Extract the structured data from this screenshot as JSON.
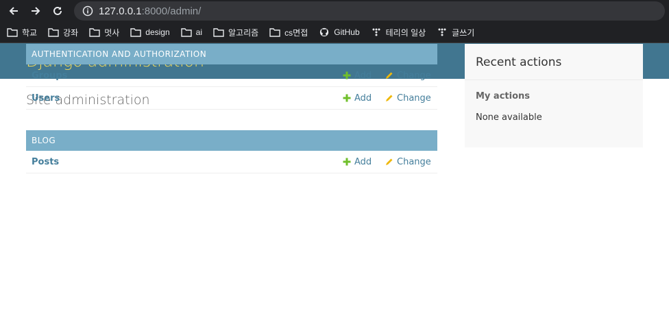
{
  "browser": {
    "url_host": "127.0.0.1",
    "url_rest": ":8000/admin/",
    "bookmarks": [
      {
        "label": "학교",
        "icon": "folder-icon"
      },
      {
        "label": "강좌",
        "icon": "folder-icon"
      },
      {
        "label": "멋사",
        "icon": "folder-icon"
      },
      {
        "label": "design",
        "icon": "folder-icon"
      },
      {
        "label": "ai",
        "icon": "folder-icon"
      },
      {
        "label": "알고리즘",
        "icon": "folder-icon"
      },
      {
        "label": "cs면접",
        "icon": "folder-icon"
      },
      {
        "label": "GitHub",
        "icon": "github-icon"
      },
      {
        "label": "테리의 일상",
        "icon": "tistory-icon"
      },
      {
        "label": "글쓰기",
        "icon": "tistory-icon"
      }
    ]
  },
  "header": {
    "brand": "Django administration"
  },
  "page": {
    "title": "Site administration"
  },
  "apps": [
    {
      "caption": "AUTHENTICATION AND AUTHORIZATION",
      "models": [
        {
          "name": "Groups",
          "add": "Add",
          "change": "Change"
        },
        {
          "name": "Users",
          "add": "Add",
          "change": "Change"
        }
      ]
    },
    {
      "caption": "BLOG",
      "models": [
        {
          "name": "Posts",
          "add": "Add",
          "change": "Change"
        }
      ]
    }
  ],
  "sidebar": {
    "title": "Recent actions",
    "subtitle": "My actions",
    "empty": "None available"
  },
  "colors": {
    "header_bg": "#417690",
    "brand": "#f5dd5d",
    "caption_bg": "#79aec8",
    "link": "#447e9b",
    "add_icon": "#70bf2b",
    "change_icon": "#efb80b"
  }
}
